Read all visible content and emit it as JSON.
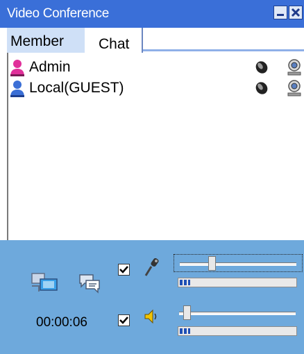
{
  "window": {
    "title": "Video Conference"
  },
  "tabs": [
    {
      "label": "Member",
      "active": true
    },
    {
      "label": "Chat",
      "active": false
    }
  ],
  "members": [
    {
      "name": "Admin",
      "avatar_color": "#e0309a",
      "speaker_icon": "speaker-icon",
      "camera_icon": "webcam-icon"
    },
    {
      "name": "Local(GUEST)",
      "avatar_color": "#3b6fd6",
      "speaker_icon": "speaker-icon",
      "camera_icon": "webcam-icon"
    }
  ],
  "controls": {
    "elapsed_time": "00:00:06",
    "mic_enabled": true,
    "speaker_enabled": true,
    "mic_volume_fraction": 0.26,
    "speaker_volume_fraction": 0.04,
    "mic_level_fraction": 0.09,
    "speaker_level_fraction": 0.09
  },
  "colors": {
    "titlebar": "#3a6fd8",
    "panel": "#6ea9dc",
    "active_tab": "#cfe0f7",
    "level_fill": "#1e4fb5"
  }
}
